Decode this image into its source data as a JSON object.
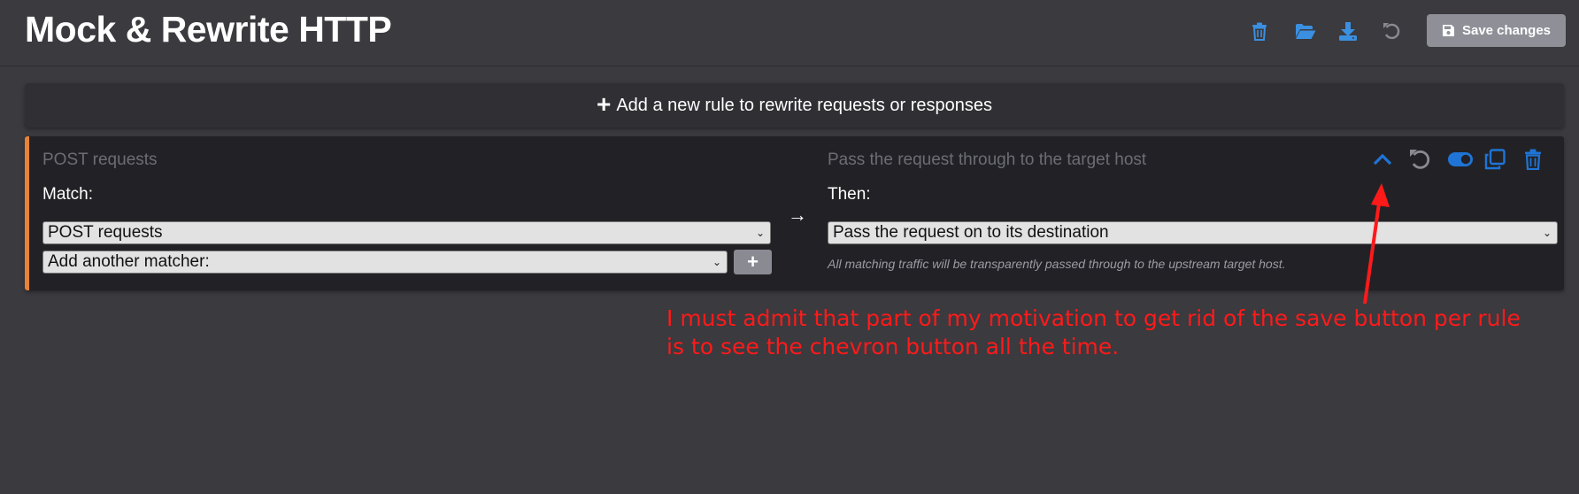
{
  "header": {
    "title": "Mock & Rewrite HTTP",
    "save_label": "Save changes",
    "icons": [
      "trash-icon",
      "folder-open-icon",
      "download-icon",
      "undo-icon",
      "save-icon"
    ]
  },
  "add_rule": {
    "label": "Add a new rule to rewrite requests or responses"
  },
  "rule": {
    "match_summary": "POST requests",
    "then_summary": "Pass the request through to the target host",
    "match_label": "Match:",
    "then_label": "Then:",
    "matcher_value": "POST requests",
    "add_matcher_value": "Add another matcher:",
    "handler_value": "Pass the request on to its destination",
    "handler_explanation": "All matching traffic will be transparently passed through to the upstream target host.",
    "accent_color": "#e6823a",
    "icons": [
      "chevron-up-icon",
      "reset-icon",
      "toggle-on-icon",
      "clone-icon",
      "delete-icon"
    ]
  },
  "annotation": {
    "text": "I must admit that part of my motivation to get rid of the save button per rule is to see the chevron button all the time.",
    "color": "#ff1a1a"
  },
  "colors": {
    "background": "#3a3a3f",
    "accent_blue": "#1f74d6",
    "card": "#222226"
  }
}
